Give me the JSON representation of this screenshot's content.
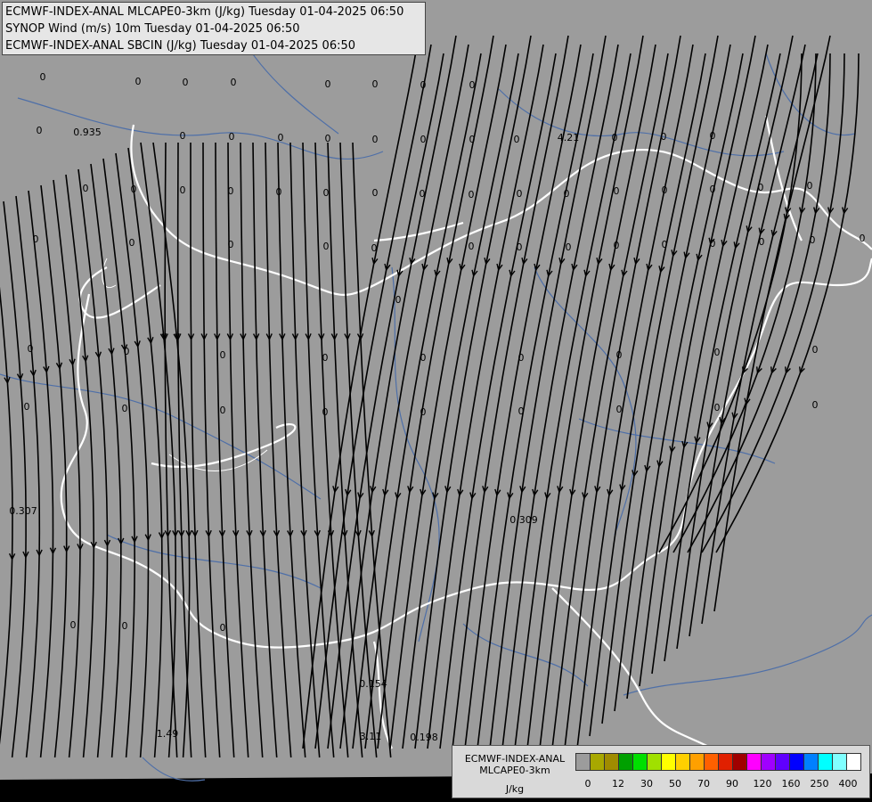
{
  "titles": [
    "ECMWF-INDEX-ANAL MLCAPE0-3km (J/kg) Tuesday 01-04-2025 06:50",
    "SYNOP Wind (m/s) 10m Tuesday 01-04-2025 06:50",
    "ECMWF-INDEX-ANAL SBCIN (J/kg) Tuesday 01-04-2025 06:50"
  ],
  "legend": {
    "name_line1": "ECMWF-INDEX-ANAL",
    "name_line2": "MLCAPE0-3km",
    "unit": "J/kg",
    "colors": [
      "#9c9c9c",
      "#a8a800",
      "#a08c00",
      "#00a000",
      "#00e000",
      "#a0e000",
      "#ffff00",
      "#ffd000",
      "#ffa000",
      "#ff6000",
      "#e02000",
      "#a00000",
      "#ff00ff",
      "#a000ff",
      "#6000ff",
      "#0000ff",
      "#0080ff",
      "#00ffff",
      "#80ffff",
      "#ffffff"
    ],
    "ticks": [
      "0",
      "12",
      "30",
      "50",
      "70",
      "90",
      "120",
      "160",
      "250",
      "400"
    ]
  },
  "colors": {
    "background": "#9c9c9c",
    "border": "#ffffff",
    "river": "#4e6fa8",
    "streamline": "#000000"
  },
  "value_labels": [
    {
      "id": "v01",
      "text": "0"
    },
    {
      "id": "v02",
      "text": "0"
    },
    {
      "id": "v03",
      "text": "0"
    },
    {
      "id": "v04",
      "text": "0"
    },
    {
      "id": "v05",
      "text": "0"
    },
    {
      "id": "v06",
      "text": "0"
    },
    {
      "id": "v07",
      "text": "0"
    },
    {
      "id": "v08",
      "text": "0"
    },
    {
      "id": "v09",
      "text": "0"
    },
    {
      "id": "v10",
      "text": "0"
    },
    {
      "id": "v11",
      "text": "0"
    },
    {
      "id": "v12",
      "text": "0"
    },
    {
      "id": "v13",
      "text": "0"
    },
    {
      "id": "v14",
      "text": "0"
    },
    {
      "id": "v15",
      "text": "0"
    },
    {
      "id": "v16",
      "text": "0"
    },
    {
      "id": "v17",
      "text": "0"
    },
    {
      "id": "v18",
      "text": "0"
    },
    {
      "id": "v19",
      "text": "0"
    },
    {
      "id": "v20",
      "text": "0"
    },
    {
      "id": "v21",
      "text": "0.935"
    },
    {
      "id": "v22",
      "text": "4.21"
    },
    {
      "id": "v23",
      "text": "0.307"
    },
    {
      "id": "v24",
      "text": "0.309"
    },
    {
      "id": "v25",
      "text": "0.154"
    },
    {
      "id": "v26",
      "text": "1.49"
    },
    {
      "id": "v27",
      "text": "3.11"
    },
    {
      "id": "v28",
      "text": "0.198"
    },
    {
      "id": "v29",
      "text": "0"
    },
    {
      "id": "v30",
      "text": "0"
    },
    {
      "id": "v31",
      "text": "0"
    },
    {
      "id": "v32",
      "text": "0"
    },
    {
      "id": "v33",
      "text": "0"
    },
    {
      "id": "v34",
      "text": "0"
    },
    {
      "id": "v35",
      "text": "0"
    },
    {
      "id": "v36",
      "text": "0"
    },
    {
      "id": "v37",
      "text": "0"
    },
    {
      "id": "v38",
      "text": "0"
    },
    {
      "id": "v39",
      "text": "0"
    },
    {
      "id": "v40",
      "text": "0"
    },
    {
      "id": "v41",
      "text": "0"
    },
    {
      "id": "v42",
      "text": "0"
    },
    {
      "id": "v43",
      "text": "0"
    },
    {
      "id": "v44",
      "text": "0"
    },
    {
      "id": "v45",
      "text": "0"
    },
    {
      "id": "v46",
      "text": "0"
    },
    {
      "id": "v47",
      "text": "0"
    },
    {
      "id": "v48",
      "text": "0"
    },
    {
      "id": "v49",
      "text": "0"
    },
    {
      "id": "v50",
      "text": "0"
    },
    {
      "id": "v51",
      "text": "0"
    },
    {
      "id": "v52",
      "text": "0"
    },
    {
      "id": "v53",
      "text": "0"
    },
    {
      "id": "v54",
      "text": "0"
    },
    {
      "id": "v55",
      "text": "0"
    },
    {
      "id": "v56",
      "text": "0"
    },
    {
      "id": "v57",
      "text": "0"
    },
    {
      "id": "v58",
      "text": "0"
    },
    {
      "id": "v59",
      "text": "0"
    },
    {
      "id": "v60",
      "text": "0"
    },
    {
      "id": "v61",
      "text": "0"
    },
    {
      "id": "v62",
      "text": "0"
    },
    {
      "id": "v63",
      "text": "0"
    },
    {
      "id": "v64",
      "text": "0"
    },
    {
      "id": "v65",
      "text": "0"
    },
    {
      "id": "v66",
      "text": "0"
    },
    {
      "id": "v67",
      "text": "0"
    },
    {
      "id": "v68",
      "text": "0"
    },
    {
      "id": "v69",
      "text": "0"
    },
    {
      "id": "v70",
      "text": "0"
    },
    {
      "id": "v71",
      "text": "0"
    },
    {
      "id": "v72",
      "text": "0"
    },
    {
      "id": "v73",
      "text": "0"
    },
    {
      "id": "v74",
      "text": "0"
    },
    {
      "id": "v75",
      "text": "0"
    },
    {
      "id": "v76",
      "text": "0"
    },
    {
      "id": "v77",
      "text": "0"
    },
    {
      "id": "v78",
      "text": "0"
    },
    {
      "id": "v79",
      "text": "0"
    },
    {
      "id": "v80",
      "text": "0"
    }
  ]
}
